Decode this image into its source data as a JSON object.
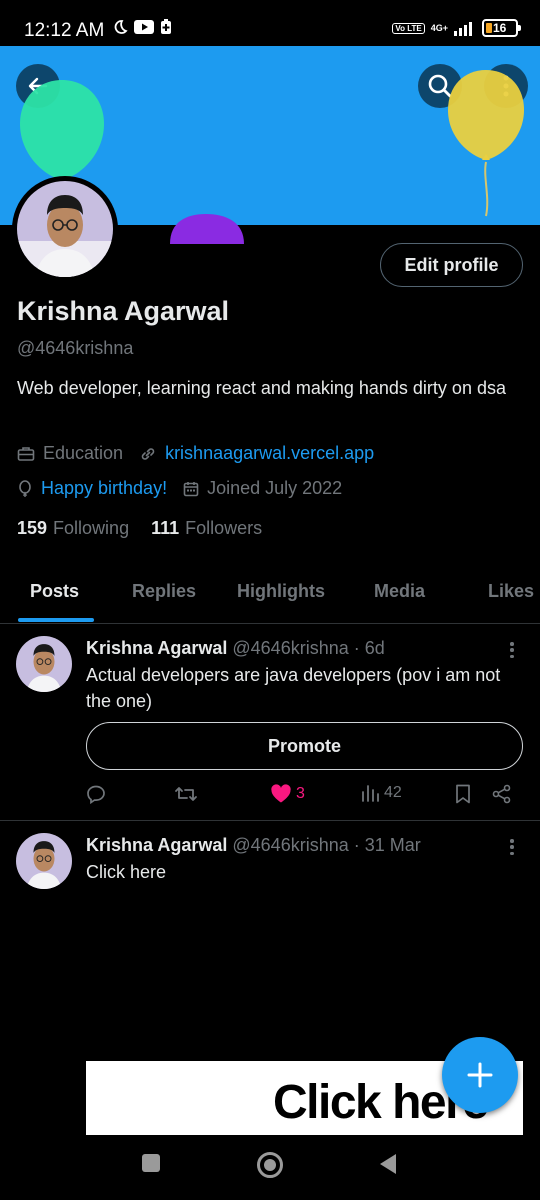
{
  "status_bar": {
    "time": "12:12 AM",
    "volte": "Vo LTE",
    "network": "4G+",
    "battery": "16"
  },
  "profile": {
    "name": "Krishna Agarwal",
    "handle": "@4646krishna",
    "bio": "Web developer, learning react and making hands dirty on dsa",
    "category": "Education",
    "website": "krishnaagarwal.vercel.app",
    "birthday": "Happy birthday!",
    "joined": "Joined July 2022",
    "following_count": "159",
    "following_label": "Following",
    "followers_count": "111",
    "followers_label": "Followers",
    "edit_label": "Edit profile"
  },
  "tabs": [
    {
      "label": "Posts",
      "active": true
    },
    {
      "label": "Replies"
    },
    {
      "label": "Highlights"
    },
    {
      "label": "Media"
    },
    {
      "label": "Likes"
    }
  ],
  "posts": [
    {
      "name": "Krishna Agarwal",
      "meta": "@4646krishna · 6d",
      "text": "Actual developers are java developers (pov i am not the one)",
      "promote_label": "Promote",
      "likes": "3",
      "views": "42"
    },
    {
      "name": "Krishna Agarwal",
      "meta": "@4646krishna · 31 Mar",
      "text": "Click here"
    }
  ],
  "ad_text": "Click here",
  "colors": {
    "accent": "#1d9bf0",
    "background": "#000000",
    "like": "#f91880",
    "balloon_green": "#2de3a7",
    "balloon_yellow": "#ead03f",
    "balloon_purple": "#8a2be2"
  },
  "icons": [
    "back-arrow-icon",
    "search-icon",
    "more-vertical-icon",
    "briefcase-icon",
    "link-icon",
    "balloon-icon",
    "calendar-icon",
    "reply-icon",
    "retweet-icon",
    "heart-icon",
    "views-icon",
    "bookmark-icon",
    "share-icon",
    "plus-icon"
  ]
}
